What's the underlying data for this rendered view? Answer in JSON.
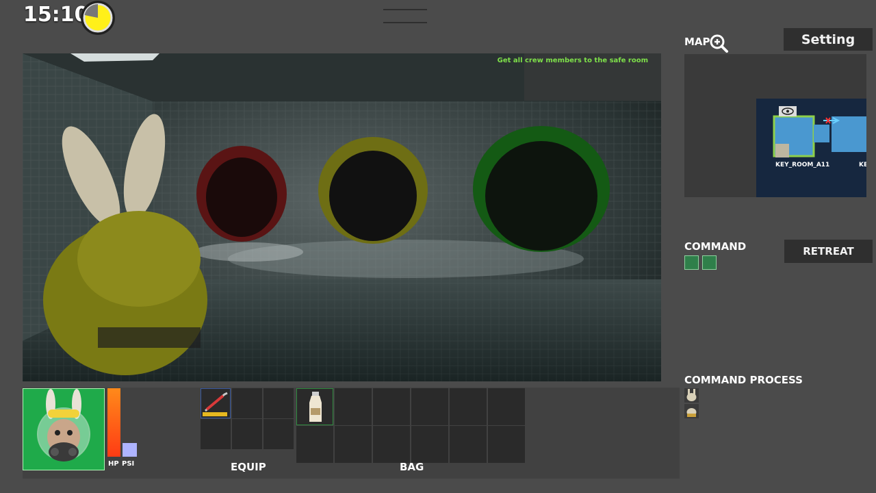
{
  "hud": {
    "time": "15:10",
    "objective": "Get all crew members to the safe room"
  },
  "map": {
    "label": "MAP",
    "zoom_icon": "zoom-in-icon",
    "rooms": [
      "KEY_ROOM_A11",
      "KE"
    ]
  },
  "settings": {
    "label": "Setting"
  },
  "command": {
    "label": "COMMAND",
    "retreat_label": "RETREAT",
    "process_label": "COMMAND PROCESS"
  },
  "status": {
    "hp_label": "HP",
    "psi_label": "PSI",
    "hp_level": 1.0,
    "psi_level": 0.2
  },
  "inventory": {
    "equip_label": "EQUIP",
    "bag_label": "BAG",
    "equip_items": [
      "crowbar-icon",
      "",
      "",
      "",
      "",
      ""
    ],
    "bag_items": [
      "milk-bottle-icon",
      "",
      "",
      "",
      "",
      "",
      "",
      "",
      "",
      "",
      "",
      ""
    ]
  },
  "colors": {
    "hp_bar": "#ff5a14",
    "psi_bar": "#aeb4ff",
    "objective_text": "#7ee04a",
    "portrait_bg": "#22c55e",
    "pipe_red": "#8c1a1a",
    "pipe_yellow": "#8c8c14",
    "pipe_green": "#1a7a1a"
  }
}
